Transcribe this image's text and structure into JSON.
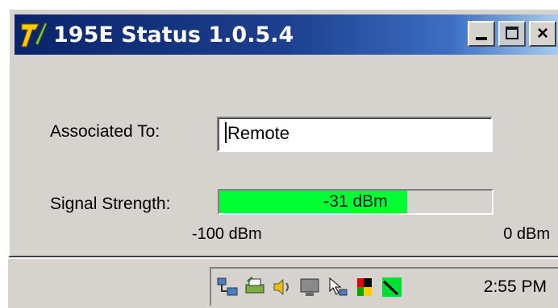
{
  "window": {
    "title": "195E Status 1.0.5.4",
    "icon": "app-logo-icon",
    "buttons": {
      "minimize": "minimize-icon",
      "maximize": "maximize-icon",
      "close": "×"
    }
  },
  "associated": {
    "label": "Associated To:",
    "value": "Remote"
  },
  "signal": {
    "label": "Signal Strength:",
    "value_text": "-31 dBm",
    "value": -31,
    "min": -100,
    "max": 0,
    "min_label": "-100 dBm",
    "max_label": "0 dBm",
    "fill_color": "#00ff33"
  },
  "taskbar": {
    "tray_icons": [
      "network-icon",
      "printer-icon",
      "speaker-icon",
      "monitor-icon",
      "mouse-icon",
      "flag-icon",
      "signal-icon"
    ],
    "clock": "2:55 PM"
  },
  "colors": {
    "titlebar_start": "#0a246a",
    "titlebar_end": "#a6caf0",
    "face": "#d6d3ce"
  }
}
